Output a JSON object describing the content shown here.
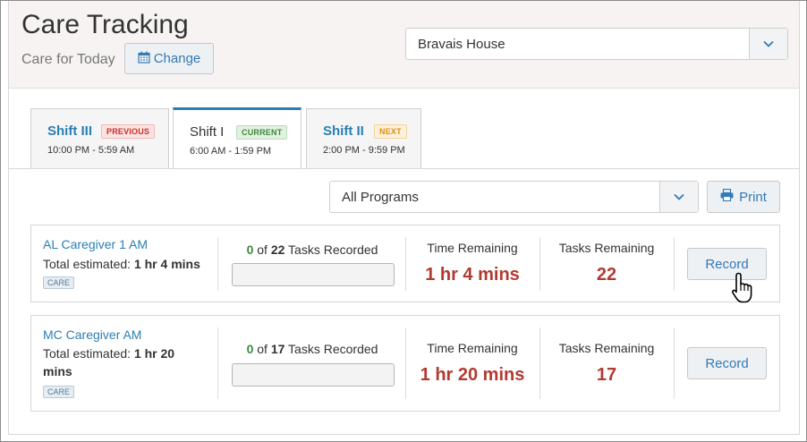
{
  "header": {
    "title": "Care Tracking",
    "subtitle": "Care for Today",
    "change_label": "Change",
    "house_value": "Bravais House"
  },
  "tabs": [
    {
      "name": "Shift III",
      "badge": "PREVIOUS",
      "time": "10:00 PM - 5:59 AM",
      "active": false
    },
    {
      "name": "Shift I",
      "badge": "CURRENT",
      "time": "6:00 AM - 1:59 PM",
      "active": true
    },
    {
      "name": "Shift II",
      "badge": "NEXT",
      "time": "2:00 PM - 9:59 PM",
      "active": false
    }
  ],
  "filters": {
    "programs_value": "All Programs",
    "print_label": "Print"
  },
  "caregivers": [
    {
      "name": "AL Caregiver 1 AM",
      "est_label": "Total estimated:",
      "est_value": "1 hr 4 mins",
      "tag": "CARE",
      "recorded": "0",
      "of_text": "of",
      "total": "22",
      "tasks_recorded_label": "Tasks Recorded",
      "progress_fraction": 0,
      "time_remaining_label": "Time Remaining",
      "time_remaining": "1 hr 4 mins",
      "tasks_remaining_label": "Tasks Remaining",
      "tasks_remaining": "22",
      "record_label": "Record"
    },
    {
      "name": "MC Caregiver AM",
      "est_label": "Total estimated:",
      "est_value": "1 hr 20 mins",
      "tag": "CARE",
      "recorded": "0",
      "of_text": "of",
      "total": "17",
      "tasks_recorded_label": "Tasks Recorded",
      "progress_fraction": 0,
      "time_remaining_label": "Time Remaining",
      "time_remaining": "1 hr 20 mins",
      "tasks_remaining_label": "Tasks Remaining",
      "tasks_remaining": "17",
      "record_label": "Record"
    }
  ],
  "colors": {
    "accent": "#2a7fb3",
    "danger": "#b33a30",
    "success": "#3c8a3c"
  }
}
